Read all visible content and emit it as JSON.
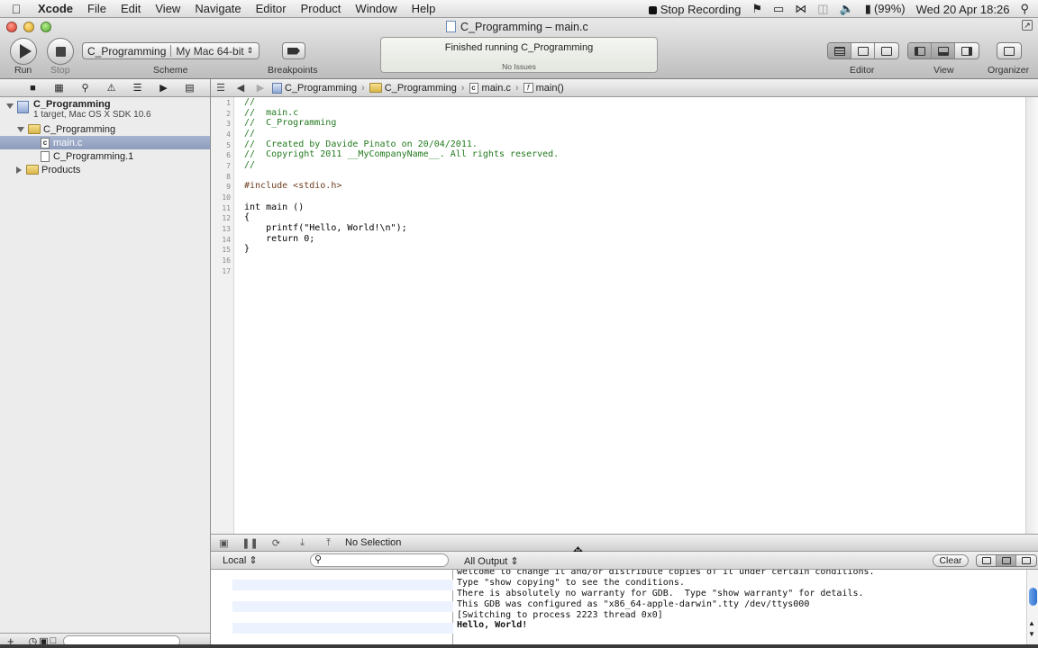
{
  "menubar": {
    "app_name": "Xcode",
    "menus": [
      "File",
      "Edit",
      "View",
      "Navigate",
      "Editor",
      "Product",
      "Window",
      "Help"
    ],
    "stop_recording": "Stop Recording",
    "battery": "(99%)",
    "clock": "Wed 20 Apr  18:26"
  },
  "window": {
    "title": "C_Programming – main.c"
  },
  "toolbar": {
    "run_label": "Run",
    "stop_label": "Stop",
    "scheme_target": "C_Programming",
    "scheme_destination": "My Mac 64-bit",
    "scheme_label": "Scheme",
    "breakpoints_label": "Breakpoints",
    "status_main": "Finished running C_Programming",
    "status_sub": "No Issues",
    "editor_label": "Editor",
    "view_label": "View",
    "organizer_label": "Organizer"
  },
  "navigator": {
    "project_name": "C_Programming",
    "project_sub": "1 target, Mac OS X SDK 10.6",
    "group_name": "C_Programming",
    "file_main": "main.c",
    "file_man": "C_Programming.1",
    "products": "Products"
  },
  "jumpbar": {
    "crumbs": [
      "C_Programming",
      "C_Programming",
      "main.c",
      "main()"
    ]
  },
  "editor": {
    "line_numbers": [
      "1",
      "2",
      "3",
      "4",
      "5",
      "6",
      "7",
      "8",
      "9",
      "10",
      "11",
      "12",
      "13",
      "14",
      "15",
      "16",
      "17"
    ],
    "lines": [
      "//",
      "//  main.c",
      "//  C_Programming",
      "//",
      "//  Created by Davide Pinato on 20/04/2011.",
      "//  Copyright 2011 __MyCompanyName__. All rights reserved.",
      "//",
      "",
      "#include <stdio.h>",
      "",
      "int main ()",
      "{",
      "    printf(\"Hello, World!\\n\");",
      "    return 0;",
      "}",
      "",
      ""
    ]
  },
  "debugbar": {
    "selection": "No Selection"
  },
  "variables": {
    "scope": "Local ⇕"
  },
  "console": {
    "output_filter": "All Output ⇕",
    "clear_label": "Clear",
    "lines": [
      "welcome to change it and/or distribute copies of it under certain conditions.",
      "Type \"show copying\" to see the conditions.",
      "There is absolutely no warranty for GDB.  Type \"show warranty\" for details.",
      "This GDB was configured as \"x86_64-apple-darwin\".tty /dev/ttys000",
      "[Switching to process 2223 thread 0x0]",
      "Hello, World!"
    ]
  }
}
